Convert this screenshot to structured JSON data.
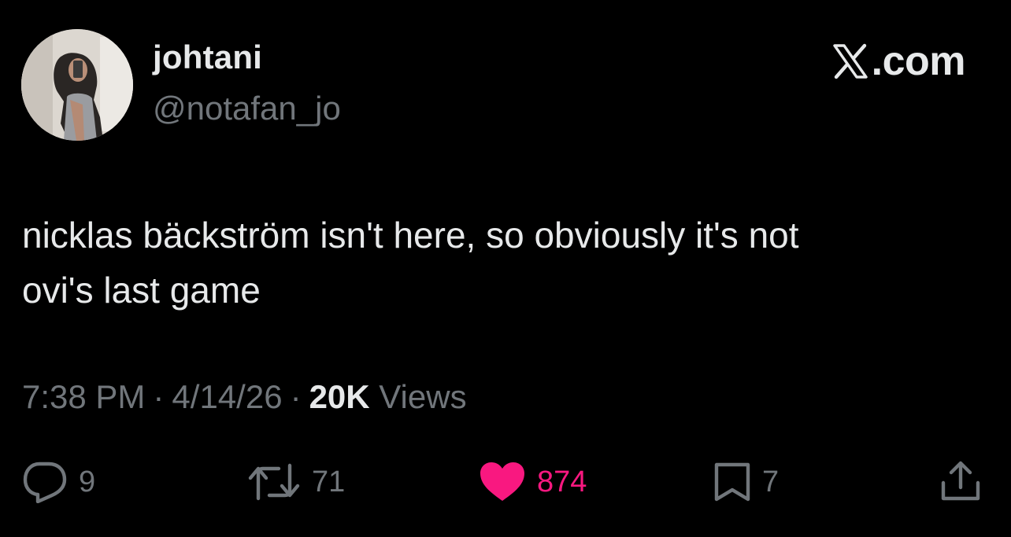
{
  "author": {
    "display_name": "johtani",
    "handle": "@notafan_jo"
  },
  "brand": {
    "text": ".com",
    "icon": "x-logo-icon"
  },
  "tweet": {
    "text": "nicklas bäckström isn't here, so obviously it's not\novi's last game",
    "time": "7:38 PM",
    "date": "4/14/26",
    "separator": "·",
    "views_count": "20K",
    "views_label": "Views"
  },
  "actions": {
    "reply": {
      "icon": "reply-icon",
      "count": "9"
    },
    "retweet": {
      "icon": "retweet-icon",
      "count": "71"
    },
    "like": {
      "icon": "heart-icon",
      "count": "874",
      "active": true
    },
    "bookmark": {
      "icon": "bookmark-icon",
      "count": "7"
    },
    "share": {
      "icon": "share-icon"
    }
  },
  "colors": {
    "background": "#000000",
    "primary_text": "#e7e9ea",
    "secondary_text": "#71767b",
    "like_active": "#f91880"
  }
}
